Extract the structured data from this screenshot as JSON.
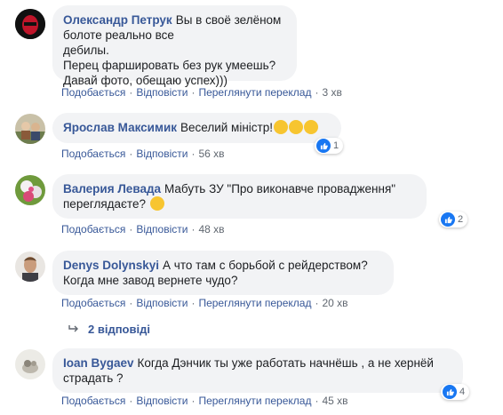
{
  "comments": [
    {
      "author": "Олександр Петрук",
      "text": "Вы в своё зелёном болоте реально все\nдебилы.\nПерец фаршировать без рук умеешь?\nДавай фото, обещаю успех)))",
      "like": "Подобається",
      "reply": "Відповісти",
      "translate": "Переглянути переклад",
      "time": "3 хв"
    },
    {
      "author": "Ярослав Максимик",
      "text": "Веселий міністр!",
      "like": "Подобається",
      "reply": "Відповісти",
      "time": "56 хв",
      "reaction_count": "1"
    },
    {
      "author": "Валерия Левада",
      "text": "Мабуть ЗУ \"Про виконавче провадження\"\nпереглядаєте?",
      "like": "Подобається",
      "reply": "Відповісти",
      "time": "48 хв",
      "reaction_count": "2"
    },
    {
      "author": "Denys Dolynskyi",
      "text": "А что там с борьбой с рейдерством?\nКогда мне завод вернете чудо?",
      "like": "Подобається",
      "reply": "Відповісти",
      "translate": "Переглянути переклад",
      "time": "20 хв"
    },
    {
      "author": "Ioan Bygaev",
      "text": "Когда Дэнчик ты уже работать начнёшь , а не хернёй\nстрадать ?",
      "like": "Подобається",
      "reply": "Відповісти",
      "translate": "Переглянути переклад",
      "time": "45 хв",
      "reaction_count": "4"
    }
  ],
  "replies_link": "2 відповіді",
  "colors": {
    "link": "#385898",
    "bubble": "#f2f3f5",
    "like": "#1877f2"
  }
}
